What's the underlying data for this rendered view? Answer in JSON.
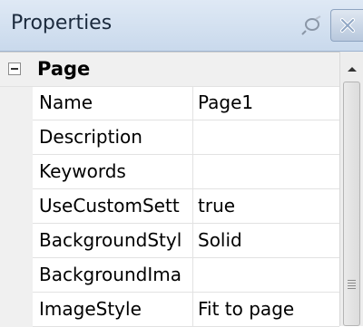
{
  "panel": {
    "title": "Properties",
    "pin_icon": "pin-icon",
    "close_icon": "close-icon"
  },
  "grid": {
    "category": {
      "label": "Page",
      "expanded": true,
      "expander_icon": "collapse-icon"
    },
    "properties": [
      {
        "name": "Name",
        "value": "Page1"
      },
      {
        "name": "Description",
        "value": ""
      },
      {
        "name": "Keywords",
        "value": ""
      },
      {
        "name": "UseCustomSett",
        "value": "true"
      },
      {
        "name": "BackgroundStyl",
        "value": "Solid"
      },
      {
        "name": "BackgroundIma",
        "value": ""
      },
      {
        "name": "ImageStyle",
        "value": "Fit to page"
      }
    ]
  },
  "scrollbar": {
    "up_icon": "chevron-up-icon",
    "grip_icon": "grip-icon"
  },
  "colors": {
    "titlebar": "#c9d9ec",
    "gutter": "#f0f0f0",
    "grid_line": "#e2e2e2"
  }
}
